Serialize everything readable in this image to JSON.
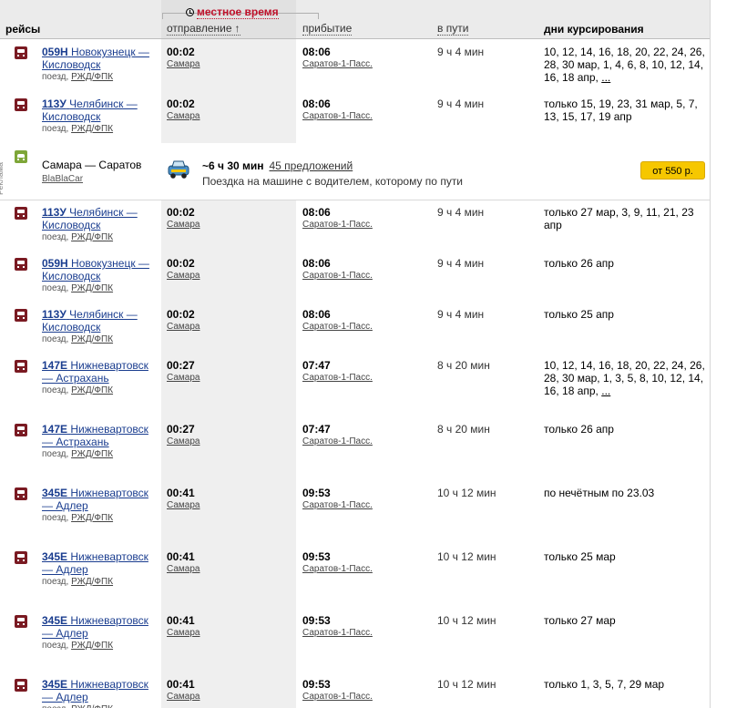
{
  "header": {
    "local_time": "местное время",
    "col_trips": "рейсы",
    "col_departure": "отправление",
    "sort_arrow": "↑",
    "col_arrival": "прибытие",
    "col_duration": "в пути",
    "col_days": "дни курсирования"
  },
  "ad": {
    "label": "Реклама",
    "route": "Самара — Саратов",
    "provider": "BlaBlaCar",
    "duration": "~6 ч 30 мин",
    "offers": "45 предложений",
    "description": "Поездка на машине с водителем, которому по пути",
    "button": "от 550 р."
  },
  "rows": [
    {
      "num": "059Н",
      "name": "Новокузнецк — Кисловодск",
      "sub": "поезд,",
      "carrier": "РЖД/ФПК",
      "dep_time": "00:02",
      "dep_station": "Самара",
      "arr_time": "08:06",
      "arr_station": "Саратов-1-Пасс.",
      "duration": "9 ч 4 мин",
      "days": "10, 12, 14, 16, 18, 20, 22, 24, 26, 28, 30 мар, 1, 4, 6, 8, 10, 12, 14, 16, 18 апр,",
      "more": "..."
    },
    {
      "num": "113У",
      "name": "Челябинск — Кисловодск",
      "sub": "поезд,",
      "carrier": "РЖД/ФПК",
      "dep_time": "00:02",
      "dep_station": "Самара",
      "arr_time": "08:06",
      "arr_station": "Саратов-1-Пасс.",
      "duration": "9 ч 4 мин",
      "days": "только 15, 19, 23, 31 мар, 5, 7, 13, 15, 17, 19 апр",
      "more": ""
    },
    {
      "num": "113У",
      "name": "Челябинск — Кисловодск",
      "sub": "поезд,",
      "carrier": "РЖД/ФПК",
      "dep_time": "00:02",
      "dep_station": "Самара",
      "arr_time": "08:06",
      "arr_station": "Саратов-1-Пасс.",
      "duration": "9 ч 4 мин",
      "days": "только 27 мар, 3, 9, 11, 21, 23 апр",
      "more": ""
    },
    {
      "num": "059Н",
      "name": "Новокузнецк — Кисловодск",
      "sub": "поезд,",
      "carrier": "РЖД/ФПК",
      "dep_time": "00:02",
      "dep_station": "Самара",
      "arr_time": "08:06",
      "arr_station": "Саратов-1-Пасс.",
      "duration": "9 ч 4 мин",
      "days": "только 26 апр",
      "more": ""
    },
    {
      "num": "113У",
      "name": "Челябинск — Кисловодск",
      "sub": "поезд,",
      "carrier": "РЖД/ФПК",
      "dep_time": "00:02",
      "dep_station": "Самара",
      "arr_time": "08:06",
      "arr_station": "Саратов-1-Пасс.",
      "duration": "9 ч 4 мин",
      "days": "только 25 апр",
      "more": ""
    },
    {
      "num": "147Е",
      "name": "Нижневартовск — Астрахань",
      "sub": "поезд,",
      "carrier": "РЖД/ФПК",
      "dep_time": "00:27",
      "dep_station": "Самара",
      "arr_time": "07:47",
      "arr_station": "Саратов-1-Пасс.",
      "duration": "8 ч 20 мин",
      "days": "10, 12, 14, 16, 18, 20, 22, 24, 26, 28, 30 мар, 1, 3, 5, 8, 10, 12, 14, 16, 18 апр,",
      "more": "..."
    },
    {
      "num": "147Е",
      "name": "Нижневартовск — Астрахань",
      "sub": "поезд,",
      "carrier": "РЖД/ФПК",
      "dep_time": "00:27",
      "dep_station": "Самара",
      "arr_time": "07:47",
      "arr_station": "Саратов-1-Пасс.",
      "duration": "8 ч 20 мин",
      "days": "только 26 апр",
      "more": ""
    },
    {
      "num": "345Е",
      "name": "Нижневартовск — Адлер",
      "sub": "поезд,",
      "carrier": "РЖД/ФПК",
      "dep_time": "00:41",
      "dep_station": "Самара",
      "arr_time": "09:53",
      "arr_station": "Саратов-1-Пасс.",
      "duration": "10 ч 12 мин",
      "days": "по нечётным по 23.03",
      "more": ""
    },
    {
      "num": "345Е",
      "name": "Нижневартовск — Адлер",
      "sub": "поезд,",
      "carrier": "РЖД/ФПК",
      "dep_time": "00:41",
      "dep_station": "Самара",
      "arr_time": "09:53",
      "arr_station": "Саратов-1-Пасс.",
      "duration": "10 ч 12 мин",
      "days": "только 25 мар",
      "more": ""
    },
    {
      "num": "345Е",
      "name": "Нижневартовск — Адлер",
      "sub": "поезд,",
      "carrier": "РЖД/ФПК",
      "dep_time": "00:41",
      "dep_station": "Самара",
      "arr_time": "09:53",
      "arr_station": "Саратов-1-Пасс.",
      "duration": "10 ч 12 мин",
      "days": "только 27 мар",
      "more": ""
    },
    {
      "num": "345Е",
      "name": "Нижневартовск — Адлер",
      "sub": "поезд,",
      "carrier": "РЖД/ФПК",
      "dep_time": "00:41",
      "dep_station": "Самара",
      "arr_time": "09:53",
      "arr_station": "Саратов-1-Пасс.",
      "duration": "10 ч 12 мин",
      "days": "только 1, 3, 5, 7, 29 мар",
      "more": ""
    }
  ],
  "colors": {
    "accent_red": "#c0102a",
    "link_blue": "#1a3d8f",
    "button_yellow": "#f6c700",
    "train_icon": "#7a1a22",
    "car_icon": "#7ea638"
  }
}
